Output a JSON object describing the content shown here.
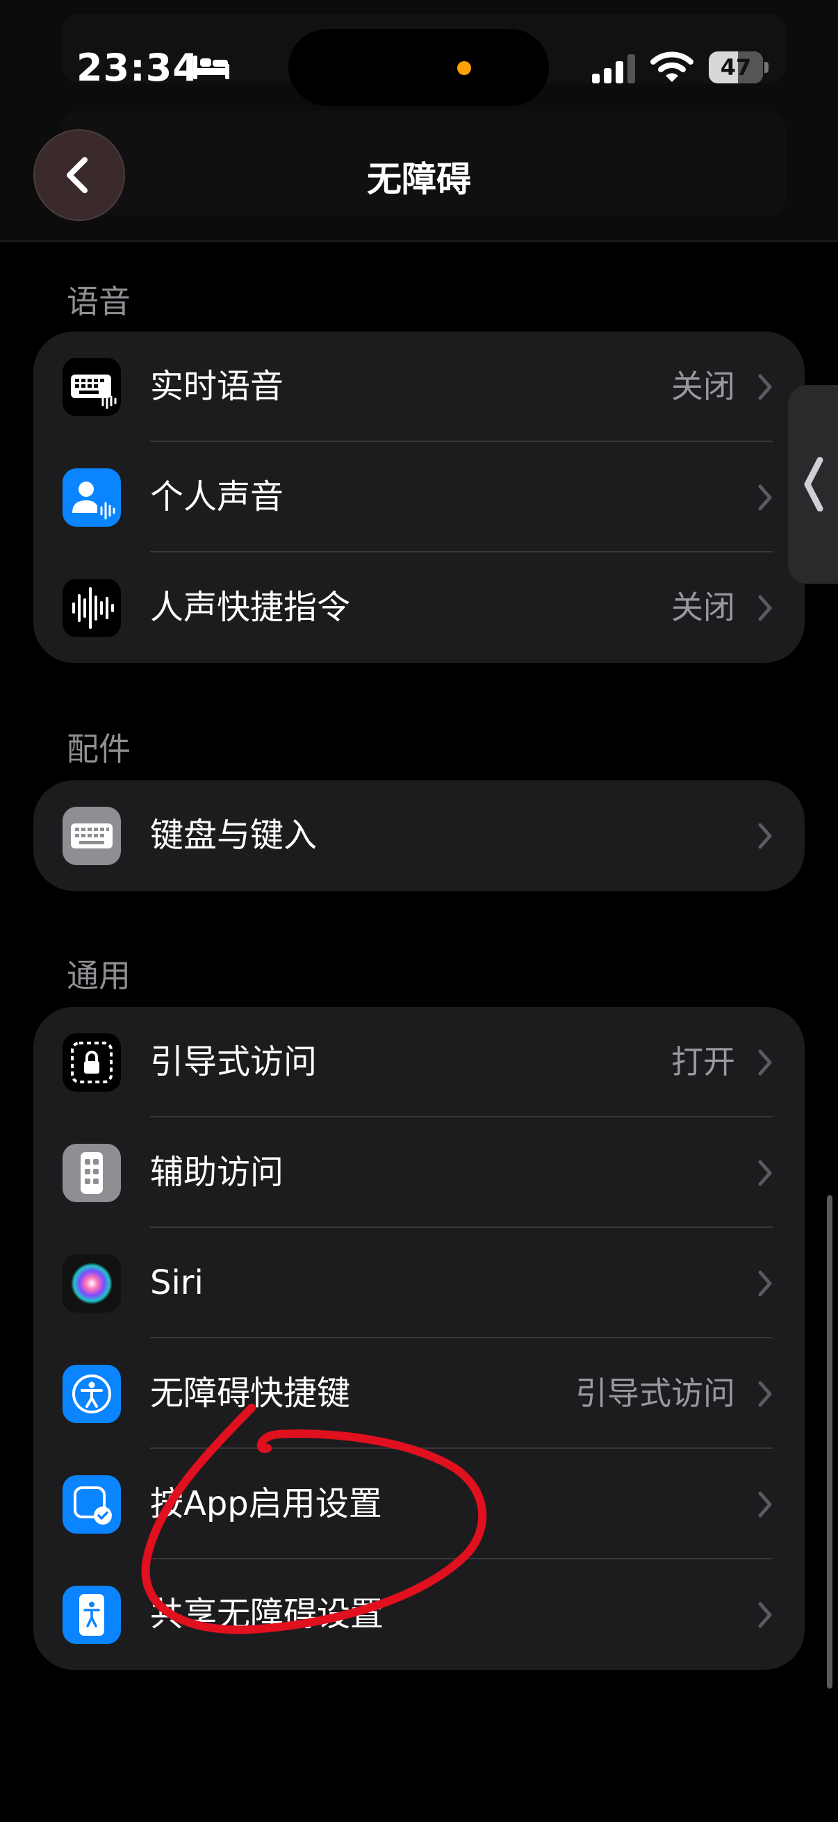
{
  "status_bar": {
    "time": "23:34",
    "battery": "47",
    "icons": [
      "bed-icon",
      "cellular-signal-icon",
      "wifi-icon",
      "battery-icon"
    ]
  },
  "nav": {
    "back_icon": "chevron-left-icon",
    "title": "无障碍"
  },
  "sections": {
    "speech": {
      "title": "语音",
      "items": [
        {
          "label": "实时语音",
          "value": "关闭",
          "icon": "live-speech-keyboard-icon"
        },
        {
          "label": "个人声音",
          "value": "",
          "icon": "personal-voice-icon"
        },
        {
          "label": "人声快捷指令",
          "value": "关闭",
          "icon": "vocal-shortcuts-waveform-icon"
        }
      ]
    },
    "accessories": {
      "title": "配件",
      "items": [
        {
          "label": "键盘与键入",
          "value": "",
          "icon": "keyboard-icon"
        }
      ]
    },
    "general": {
      "title": "通用",
      "items": [
        {
          "label": "引导式访问",
          "value": "打开",
          "icon": "guided-access-lock-icon"
        },
        {
          "label": "辅助访问",
          "value": "",
          "icon": "assistive-access-icon"
        },
        {
          "label": "Siri",
          "value": "",
          "icon": "siri-icon"
        },
        {
          "label": "无障碍快捷键",
          "value": "引导式访问",
          "icon": "accessibility-shortcut-icon"
        },
        {
          "label": "按App启用设置",
          "value": "",
          "icon": "per-app-settings-icon"
        },
        {
          "label": "共享无障碍设置",
          "value": "",
          "icon": "share-accessibility-icon"
        }
      ]
    }
  },
  "colors": {
    "background": "#000000",
    "group_bg": "#1c1c1e",
    "accent_blue": "#0a84ff",
    "annotation_red": "#e0101e",
    "secondary_text": "#98989d"
  }
}
